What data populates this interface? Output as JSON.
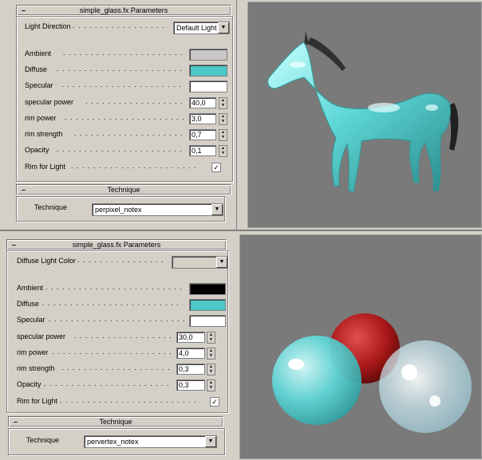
{
  "top": {
    "rollout_title": "simple_glass.fx Parameters",
    "collapse_symbol": "–",
    "light_direction_label": "Light Direction",
    "light_direction_value": "Default Light",
    "ambient_label": "Ambient",
    "ambient_color": "#c8c8c8",
    "diffuse_label": "Diffuse",
    "diffuse_color": "#4cc8c8",
    "specular_label": "Specular",
    "specular_color": "#ffffff",
    "specular_power_label": "specular power",
    "specular_power_value": "40,0",
    "rim_power_label": "rim power",
    "rim_power_value": "3,0",
    "rim_strength_label": "rim strength",
    "rim_strength_value": "0,7",
    "opacity_label": "Opacity",
    "opacity_value": "0,1",
    "rim_for_light_label": "Rim for Light",
    "rim_for_light_checked": "✓",
    "technique_rollout_title": "Technique",
    "technique_label": "Technique",
    "technique_value": "perpixel_notex"
  },
  "bottom": {
    "rollout_title": "simple_glass.fx Parameters",
    "collapse_symbol": "–",
    "diffuse_light_color_label": "Diffuse Light Color",
    "diffuse_light_color_value": "",
    "ambient_label": "Ambient",
    "ambient_color": "#000000",
    "diffuse_label": "Diffuse",
    "diffuse_color": "#4cc8c8",
    "specular_label": "Specular",
    "specular_color": "#ffffff",
    "specular_power_label": "specular power",
    "specular_power_value": "30,0",
    "rim_power_label": "rim power",
    "rim_power_value": "4,0",
    "rim_strength_label": "rim strength",
    "rim_strength_value": "0,3",
    "opacity_label": "Opacity",
    "opacity_value": "0,3",
    "rim_for_light_label": "Rim for Light",
    "rim_for_light_checked": "✓",
    "technique_rollout_title": "Technique",
    "technique_label": "Technique",
    "technique_value": "pervertex_notex"
  },
  "viewport_background": "#7a7a7a",
  "glass_color": "#5fd8d8",
  "red_sphere_color": "#a81818"
}
